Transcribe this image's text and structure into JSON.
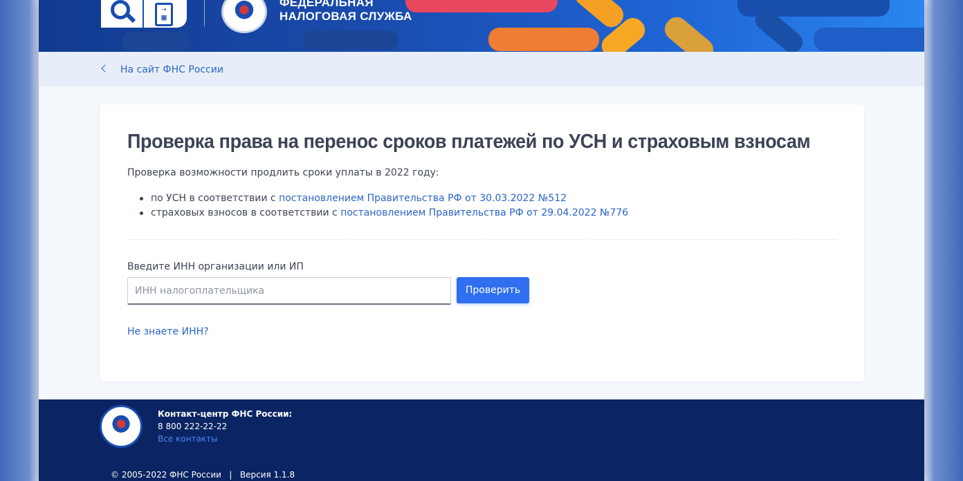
{
  "header": {
    "title_line1": "ФЕДЕРАЛЬНАЯ",
    "title_line2": "НАЛОГОВАЯ СЛУЖБА",
    "search_icon": "magnifier-icon",
    "calc_icon": "calculator-icon"
  },
  "backbar": {
    "link_label": "На сайт ФНС России"
  },
  "main": {
    "title": "Проверка права на перенос сроков платежей по УСН и страховым взносам",
    "intro": "Проверка возможности продлить сроки уплаты в 2022 году:",
    "bullets": [
      {
        "prefix": "по УСН в соответствии с ",
        "link": "постановлением Правительства РФ от 30.03.2022 №512"
      },
      {
        "prefix": "страховых взносов в соответствии с ",
        "link": "постановлением Правительства РФ от 29.04.2022 №776"
      }
    ],
    "field_label": "Введите ИНН организации или ИП",
    "field_placeholder": "ИНН налогоплательщика",
    "field_value": "",
    "submit_label": "Проверить",
    "help_link": "Не знаете ИНН?"
  },
  "footer": {
    "contact_title": "Контакт-центр ФНС России:",
    "phone": "8 800 222-22-22",
    "all_contacts": "Все контакты",
    "copyright": "© 2005-2022 ФНС России   |   Версия 1.1.8"
  },
  "colors": {
    "accent": "#2f6ff0",
    "link": "#2a64c7",
    "footer_bg": "#0b2463",
    "header_bg": "#1a4db0"
  }
}
